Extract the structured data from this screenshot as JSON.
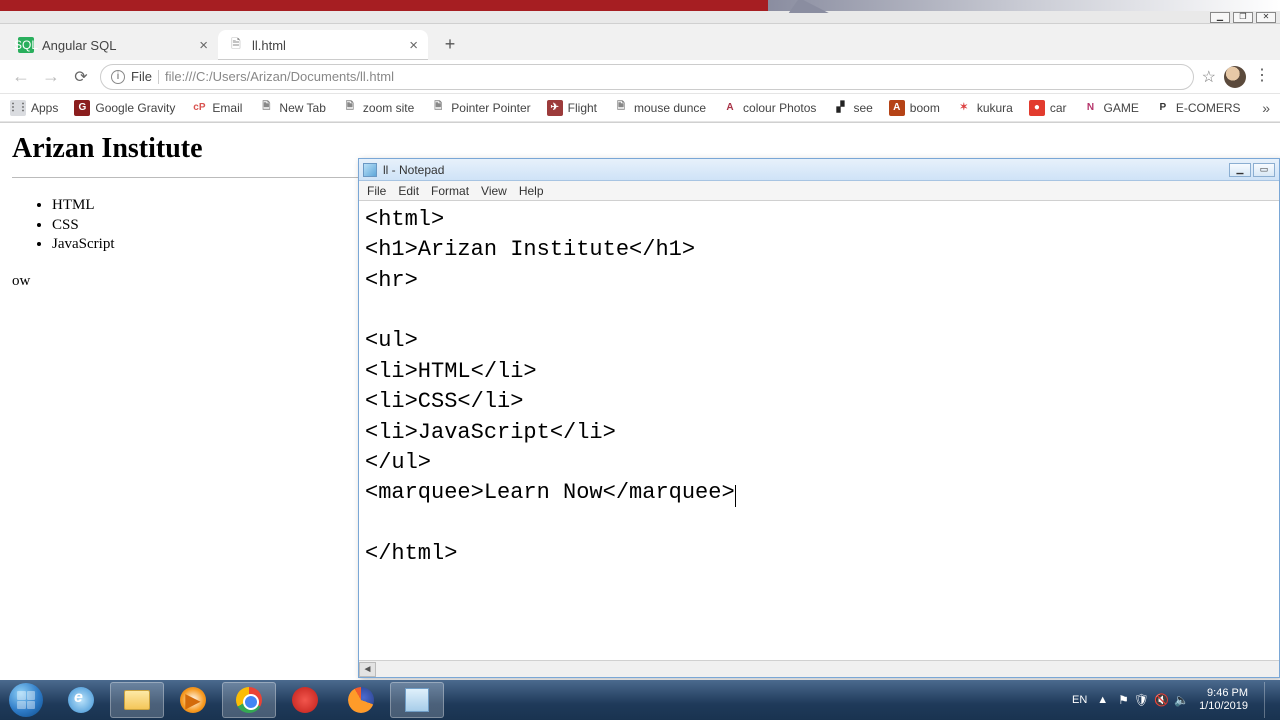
{
  "window_controls": {
    "min": "▁",
    "max": "❐",
    "close": "✕"
  },
  "tabs": [
    {
      "title": "Angular SQL",
      "favclass": "fav-ng",
      "favtext": "SQL"
    },
    {
      "title": "ll.html",
      "favclass": "fav-doc",
      "favtext": "🗎"
    }
  ],
  "addr": {
    "info": "i",
    "prefix": "File",
    "path": "file:///C:/Users/Arizan/Documents/ll.html"
  },
  "nav_icons": {
    "back": "←",
    "forward": "→",
    "reload": "⟳",
    "plus": "+",
    "star": "☆",
    "dots": "⋮",
    "more": "»"
  },
  "bookmarks": [
    {
      "label": "Apps",
      "bg": "#dadce0",
      "fg": "#555",
      "txt": "⋮⋮"
    },
    {
      "label": "Google Gravity",
      "bg": "#8b1e1e",
      "fg": "#fff",
      "txt": "G"
    },
    {
      "label": "Email",
      "bg": "#ffffff",
      "fg": "#d9534f",
      "txt": "cP"
    },
    {
      "label": "New Tab",
      "bg": "#ffffff",
      "fg": "#888",
      "txt": "🗎"
    },
    {
      "label": "zoom site",
      "bg": "#ffffff",
      "fg": "#888",
      "txt": "🗎"
    },
    {
      "label": "Pointer Pointer",
      "bg": "#ffffff",
      "fg": "#888",
      "txt": "🗎"
    },
    {
      "label": "Flight",
      "bg": "#9c3b3b",
      "fg": "#fff",
      "txt": "✈"
    },
    {
      "label": "mouse dunce",
      "bg": "#ffffff",
      "fg": "#888",
      "txt": "🗎"
    },
    {
      "label": "colour Photos",
      "bg": "#ffffff",
      "fg": "#a83246",
      "txt": "A"
    },
    {
      "label": "see",
      "bg": "#ffffff",
      "fg": "#222",
      "txt": "▞"
    },
    {
      "label": "boom",
      "bg": "#b54316",
      "fg": "#fff",
      "txt": "A"
    },
    {
      "label": "kukura",
      "bg": "#ffffff",
      "fg": "#d44",
      "txt": "✶"
    },
    {
      "label": "car",
      "bg": "#e23b2e",
      "fg": "#fff",
      "txt": "●"
    },
    {
      "label": "GAME",
      "bg": "#ffffff",
      "fg": "#b5336a",
      "txt": "N"
    },
    {
      "label": "E-COMERS",
      "bg": "#ffffff",
      "fg": "#333",
      "txt": "P"
    }
  ],
  "page": {
    "heading": "Arizan Institute",
    "items": [
      "HTML",
      "CSS",
      "JavaScript"
    ],
    "marquee": "ow"
  },
  "notepad": {
    "title": "ll - Notepad",
    "menus": [
      "File",
      "Edit",
      "Format",
      "View",
      "Help"
    ],
    "lines": [
      "<html>",
      "<h1>Arizan Institute</h1>",
      "<hr>",
      "",
      "<ul>",
      "<li>HTML</li>",
      "<li>CSS</li>",
      "<li>JavaScript</li>",
      "</ul>",
      "<marquee>Learn Now</marquee>",
      "",
      "</html>"
    ],
    "wc": {
      "min": "▁",
      "max": "▭",
      "close": "✕"
    },
    "scroll_left": "◄"
  },
  "taskbar": {
    "lang": "EN",
    "tray_up": "▲",
    "tray_icons": [
      "⚑",
      "🛡",
      "🔇",
      "🔈"
    ],
    "time": "9:46 PM",
    "date": "1/10/2019"
  }
}
